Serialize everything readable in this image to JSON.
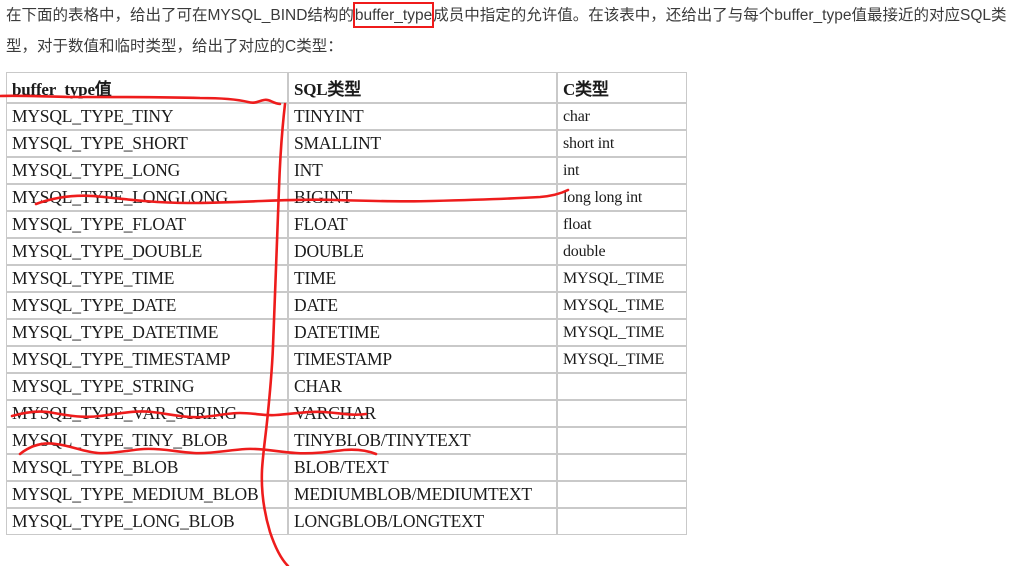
{
  "document": {
    "intro": {
      "part1": "在下面的表格中，给出了可在MYSQL_BIND结构的",
      "highlight": "buffer_type",
      "part2": "成员中指定的允许值。在该表中，还给出了与每个buffer_type值最接近的对应SQL类型，对于数值和临时类型，给出了对应的C类型："
    },
    "table": {
      "headers": [
        "buffer_type值",
        "SQL类型",
        "C类型"
      ],
      "rows": [
        [
          "MYSQL_TYPE_TINY",
          "TINYINT",
          "char"
        ],
        [
          "MYSQL_TYPE_SHORT",
          "SMALLINT",
          "short int"
        ],
        [
          "MYSQL_TYPE_LONG",
          "INT",
          "int"
        ],
        [
          "MYSQL_TYPE_LONGLONG",
          "BIGINT",
          "long long int"
        ],
        [
          "MYSQL_TYPE_FLOAT",
          "FLOAT",
          "float"
        ],
        [
          "MYSQL_TYPE_DOUBLE",
          "DOUBLE",
          "double"
        ],
        [
          "MYSQL_TYPE_TIME",
          "TIME",
          "MYSQL_TIME"
        ],
        [
          "MYSQL_TYPE_DATE",
          "DATE",
          "MYSQL_TIME"
        ],
        [
          "MYSQL_TYPE_DATETIME",
          "DATETIME",
          "MYSQL_TIME"
        ],
        [
          "MYSQL_TYPE_TIMESTAMP",
          "TIMESTAMP",
          "MYSQL_TIME"
        ],
        [
          "MYSQL_TYPE_STRING",
          "CHAR",
          ""
        ],
        [
          "MYSQL_TYPE_VAR_STRING",
          "VARCHAR",
          ""
        ],
        [
          "MYSQL_TYPE_TINY_BLOB",
          "TINYBLOB/TINYTEXT",
          ""
        ],
        [
          "MYSQL_TYPE_BLOB",
          "BLOB/TEXT",
          ""
        ],
        [
          "MYSQL_TYPE_MEDIUM_BLOB",
          "MEDIUMBLOB/MEDIUMTEXT",
          ""
        ],
        [
          "MYSQL_TYPE_LONG_BLOB",
          "LONGBLOB/LONGTEXT",
          ""
        ]
      ]
    },
    "annotation": {
      "color": "#ee1c1c",
      "marks": [
        "box-around-buffer-type",
        "horizontal-line-under-header-row",
        "long-vertical-line-through-column-divider",
        "horizontal-line-through-longlong-row",
        "underline-under-string-char-row",
        "underline-over-tiny-blob-row"
      ]
    }
  }
}
